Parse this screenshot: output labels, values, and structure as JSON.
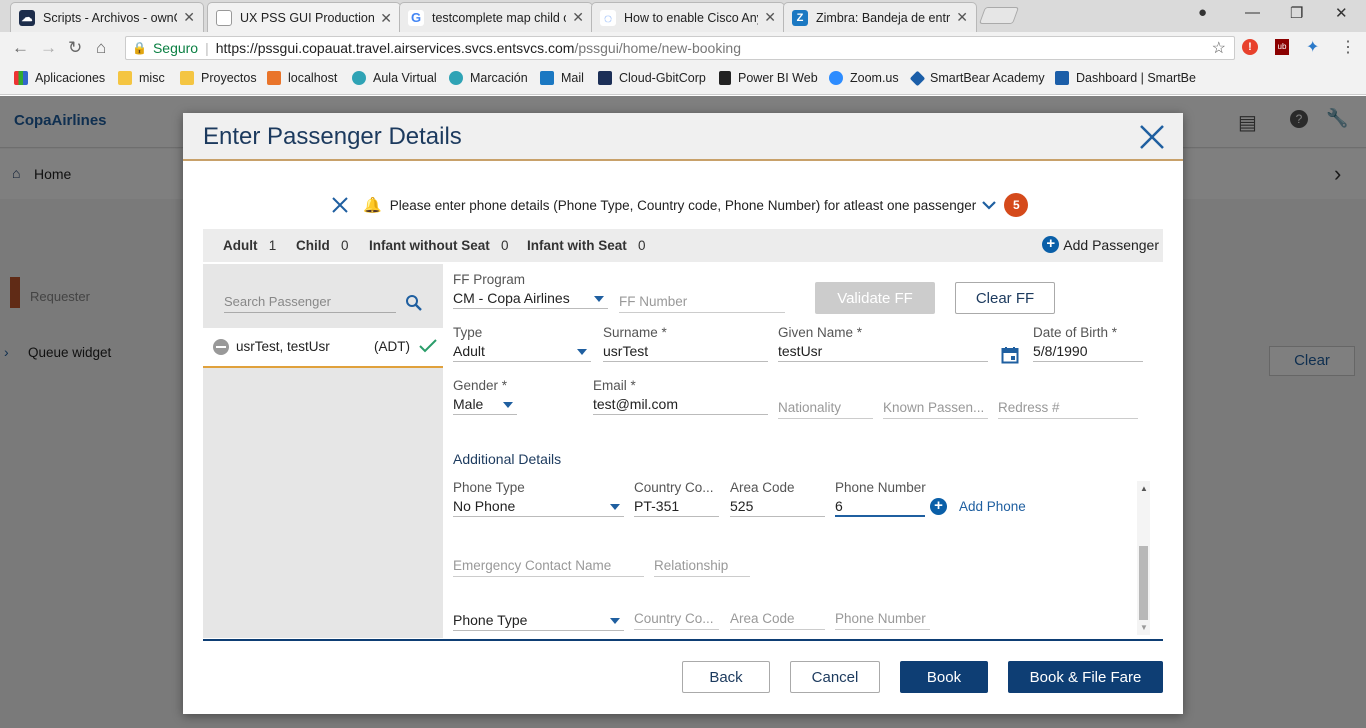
{
  "browser": {
    "tabs": [
      {
        "title": "Scripts - Archivos - ownC",
        "active": false
      },
      {
        "title": "UX PSS GUI Production",
        "active": true
      },
      {
        "title": "testcomplete map child o",
        "active": false
      },
      {
        "title": "How to enable Cisco Any",
        "active": false
      },
      {
        "title": "Zimbra: Bandeja de entra",
        "active": false
      }
    ],
    "secure_label": "Seguro",
    "url_host": "https://pssgui.copauat.travel.airservices.svcs.entsvcs.com",
    "url_path": "/pssgui/home/new-booking",
    "bookmarks": [
      "Aplicaciones",
      "misc",
      "Proyectos",
      "localhost",
      "Aula Virtual",
      "Marcación",
      "Mail",
      "Cloud-GbitCorp",
      "Power BI Web",
      "Zoom.us",
      "SmartBear Academy",
      "Dashboard | SmartBe"
    ]
  },
  "app": {
    "logo": "CopaAirlines",
    "nav_home": "Home",
    "requester_placeholder": "Requester",
    "queue_widget": "Queue widget",
    "clear_label": "Clear"
  },
  "modal": {
    "title": "Enter Passenger Details",
    "alert_text": "Please enter phone details (Phone Type, Country code, Phone Number) for atleast one passenger",
    "alert_count": "5",
    "counts": {
      "adult_label": "Adult",
      "adult": "1",
      "child_label": "Child",
      "child": "0",
      "infant_no_seat_label": "Infant without Seat",
      "infant_no_seat": "0",
      "infant_seat_label": "Infant with Seat",
      "infant_seat": "0"
    },
    "add_passenger": "Add Passenger",
    "search_placeholder": "Search Passenger",
    "passenger": {
      "name": "usrTest, testUsr",
      "type": "(ADT)"
    },
    "ff_program_label": "FF Program",
    "ff_program": "CM - Copa Airlines",
    "ff_number_placeholder": "FF Number",
    "validate_ff": "Validate FF",
    "clear_ff": "Clear FF",
    "type_label": "Type",
    "type": "Adult",
    "surname_label": "Surname *",
    "surname": "usrTest",
    "given_label": "Given Name *",
    "given": "testUsr",
    "dob_label": "Date of Birth *",
    "dob": "5/8/1990",
    "gender_label": "Gender *",
    "gender": "Male",
    "email_label": "Email *",
    "email": "test@mil.com",
    "nationality_ph": "Nationality",
    "known_pass_ph": "Known Passen...",
    "redress_ph": "Redress #",
    "additional_details": "Additional Details",
    "phone_type_label": "Phone Type",
    "phone_type": "No Phone",
    "country_code_label": "Country Co...",
    "country_code": "PT-351",
    "area_code_label": "Area Code",
    "area_code": "525",
    "phone_number_label": "Phone Number",
    "phone_number": "6",
    "add_phone": "Add Phone",
    "emergency_name_ph": "Emergency Contact Name",
    "relationship_ph": "Relationship",
    "phone_type_ph2": "Phone Type",
    "country_code_ph2": "Country Co...",
    "area_code_ph2": "Area Code",
    "phone_number_ph2": "Phone Number",
    "buttons": {
      "back": "Back",
      "cancel": "Cancel",
      "book": "Book",
      "book_file": "Book & File Fare"
    }
  }
}
